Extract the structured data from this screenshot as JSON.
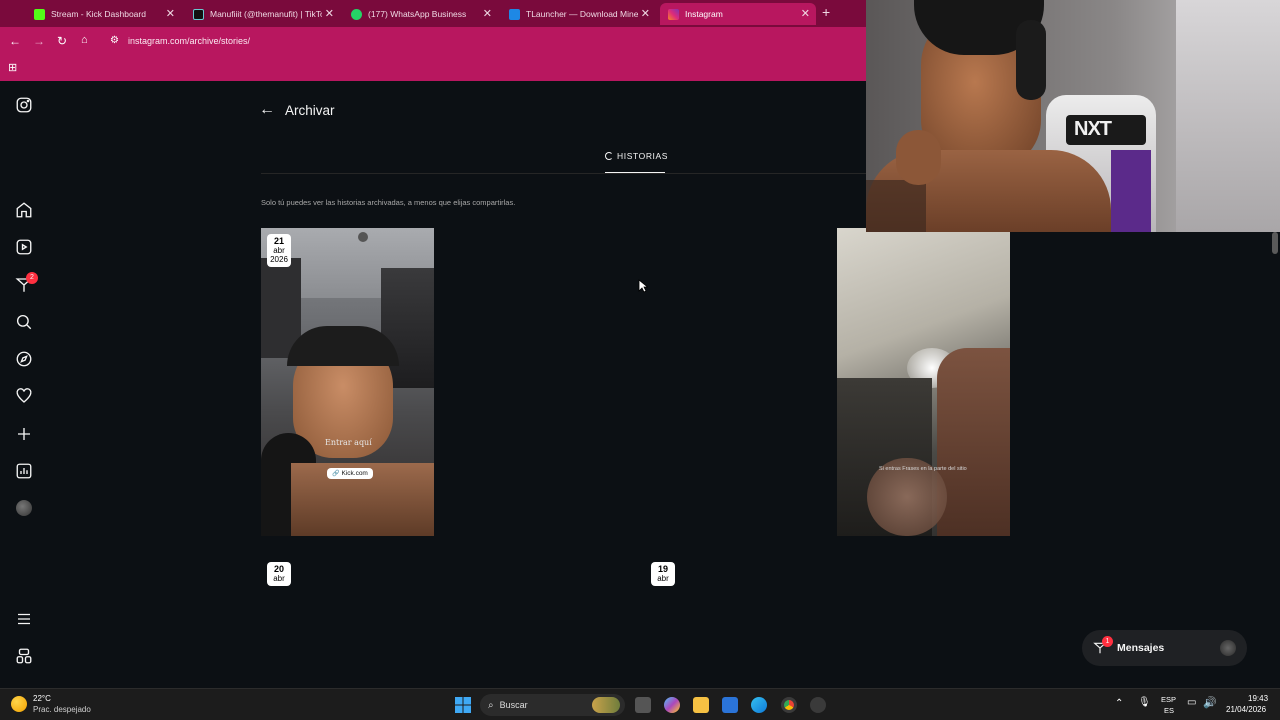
{
  "browser": {
    "tabs": [
      {
        "label": "Stream - Kick Dashboard",
        "icon": "kick-icon",
        "color": "#53fc18"
      },
      {
        "label": "Manufiiit (@themanufit) | TikTok",
        "icon": "tiktok-icon",
        "color": "#000000"
      },
      {
        "label": "(177) WhatsApp Business",
        "icon": "whatsapp-icon",
        "color": "#25d366"
      },
      {
        "label": "TLauncher — Download Minecraft",
        "icon": "tlauncher-icon",
        "color": "#1e88e5"
      },
      {
        "label": "Instagram",
        "icon": "instagram-icon",
        "color": "#e1306c"
      }
    ],
    "url": "instagram.com/archive/stories/",
    "accent": "#b8175f"
  },
  "sidebar": {
    "items": [
      {
        "name": "instagram-logo-icon"
      },
      {
        "name": "home-icon"
      },
      {
        "name": "reels-icon"
      },
      {
        "name": "messages-icon",
        "badge": "2"
      },
      {
        "name": "search-icon"
      },
      {
        "name": "explore-icon"
      },
      {
        "name": "notifications-icon"
      },
      {
        "name": "create-icon"
      },
      {
        "name": "dashboard-icon"
      },
      {
        "name": "profile-avatar"
      },
      {
        "name": "more-menu-icon"
      },
      {
        "name": "also-from-meta-icon"
      }
    ]
  },
  "archive": {
    "title": "Archivar",
    "tab_label": "HISTORIAS",
    "info": "Solo tú puedes ver las historias archivadas, a menos que elijas compartirlas.",
    "stories": [
      {
        "day": "21",
        "month": "abr",
        "year": "2026",
        "overlay_text": "Entrar aquí",
        "link_sticker": "Kick.com"
      },
      {
        "caption": "Si entras Frases en la parte del sitio"
      }
    ],
    "date_markers": [
      {
        "day": "20",
        "month": "abr"
      },
      {
        "day": "19",
        "month": "abr"
      }
    ]
  },
  "messages": {
    "label": "Mensajes",
    "badge": "1"
  },
  "taskbar": {
    "weather_temp": "22°C",
    "weather_desc": "Prac. despejado",
    "search_placeholder": "Buscar",
    "lang_top": "ESP",
    "lang_bottom": "ES",
    "time": "19:43",
    "date": "21/04/2026"
  }
}
